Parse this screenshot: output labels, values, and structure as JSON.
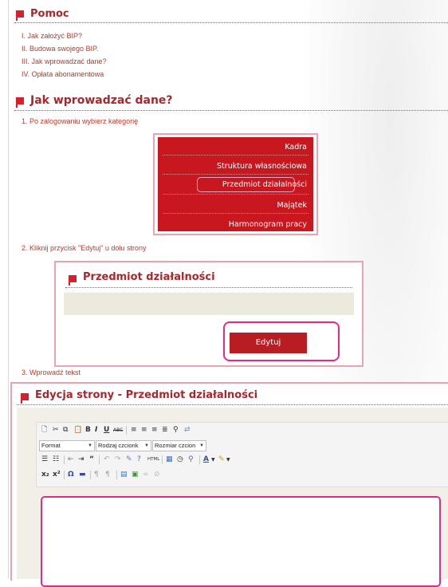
{
  "pomoc": {
    "title": "Pomoc",
    "links": [
      "I. Jak założyć BIP?",
      "II. Budowa swojego BIP.",
      "III. Jak wprowadzać dane?",
      "IV. Opłata abonamentowa"
    ]
  },
  "section": {
    "title": "Jak wprowadzać dane?",
    "step1": "1. Po zalogowaniu wybierz kategorię",
    "step2": "2. Kliknij przycisk \"Edytuj\" u dołu strony",
    "step3": "3. Wprowadź tekst"
  },
  "menu": {
    "items": [
      "Kadra",
      "Struktura własnościowa",
      "Przedmiot działalności",
      "Majątek",
      "Harmonogram pracy"
    ],
    "highlighted_index": 2
  },
  "edit_panel": {
    "title": "Przedmiot działalności",
    "button": "Edytuj"
  },
  "editor": {
    "title": "Edycja strony - Przedmiot działalności",
    "format_select": "Format",
    "font_select": "Rodzaj czcionk",
    "size_select": "Rozmiar czcion"
  },
  "colors": {
    "accent": "#d6202b",
    "title_red": "#a8272d",
    "menu_red": "#c8171e",
    "highlight_pink": "#e32a8a"
  }
}
